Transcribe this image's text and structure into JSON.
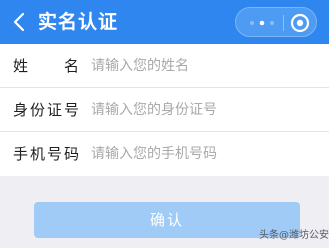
{
  "header": {
    "back_icon": "chevron-left-icon",
    "title": "实名认证",
    "capsule": {
      "more_icon": "ellipsis-icon",
      "close_icon": "circle-close-icon"
    }
  },
  "form": {
    "rows": [
      {
        "label": "姓　名",
        "placeholder": "请输入您的姓名"
      },
      {
        "label": "身份证号",
        "placeholder": "请输入您的身份证号"
      },
      {
        "label": "手机号码",
        "placeholder": "请输入您的手机号码"
      }
    ]
  },
  "confirm_button": {
    "label": "确认"
  },
  "watermark": {
    "text": "头条@潍坊公安"
  },
  "colors": {
    "header_blue": "#2f86ee",
    "button_disabled": "#9fcbf6",
    "background": "#eeeef3"
  }
}
